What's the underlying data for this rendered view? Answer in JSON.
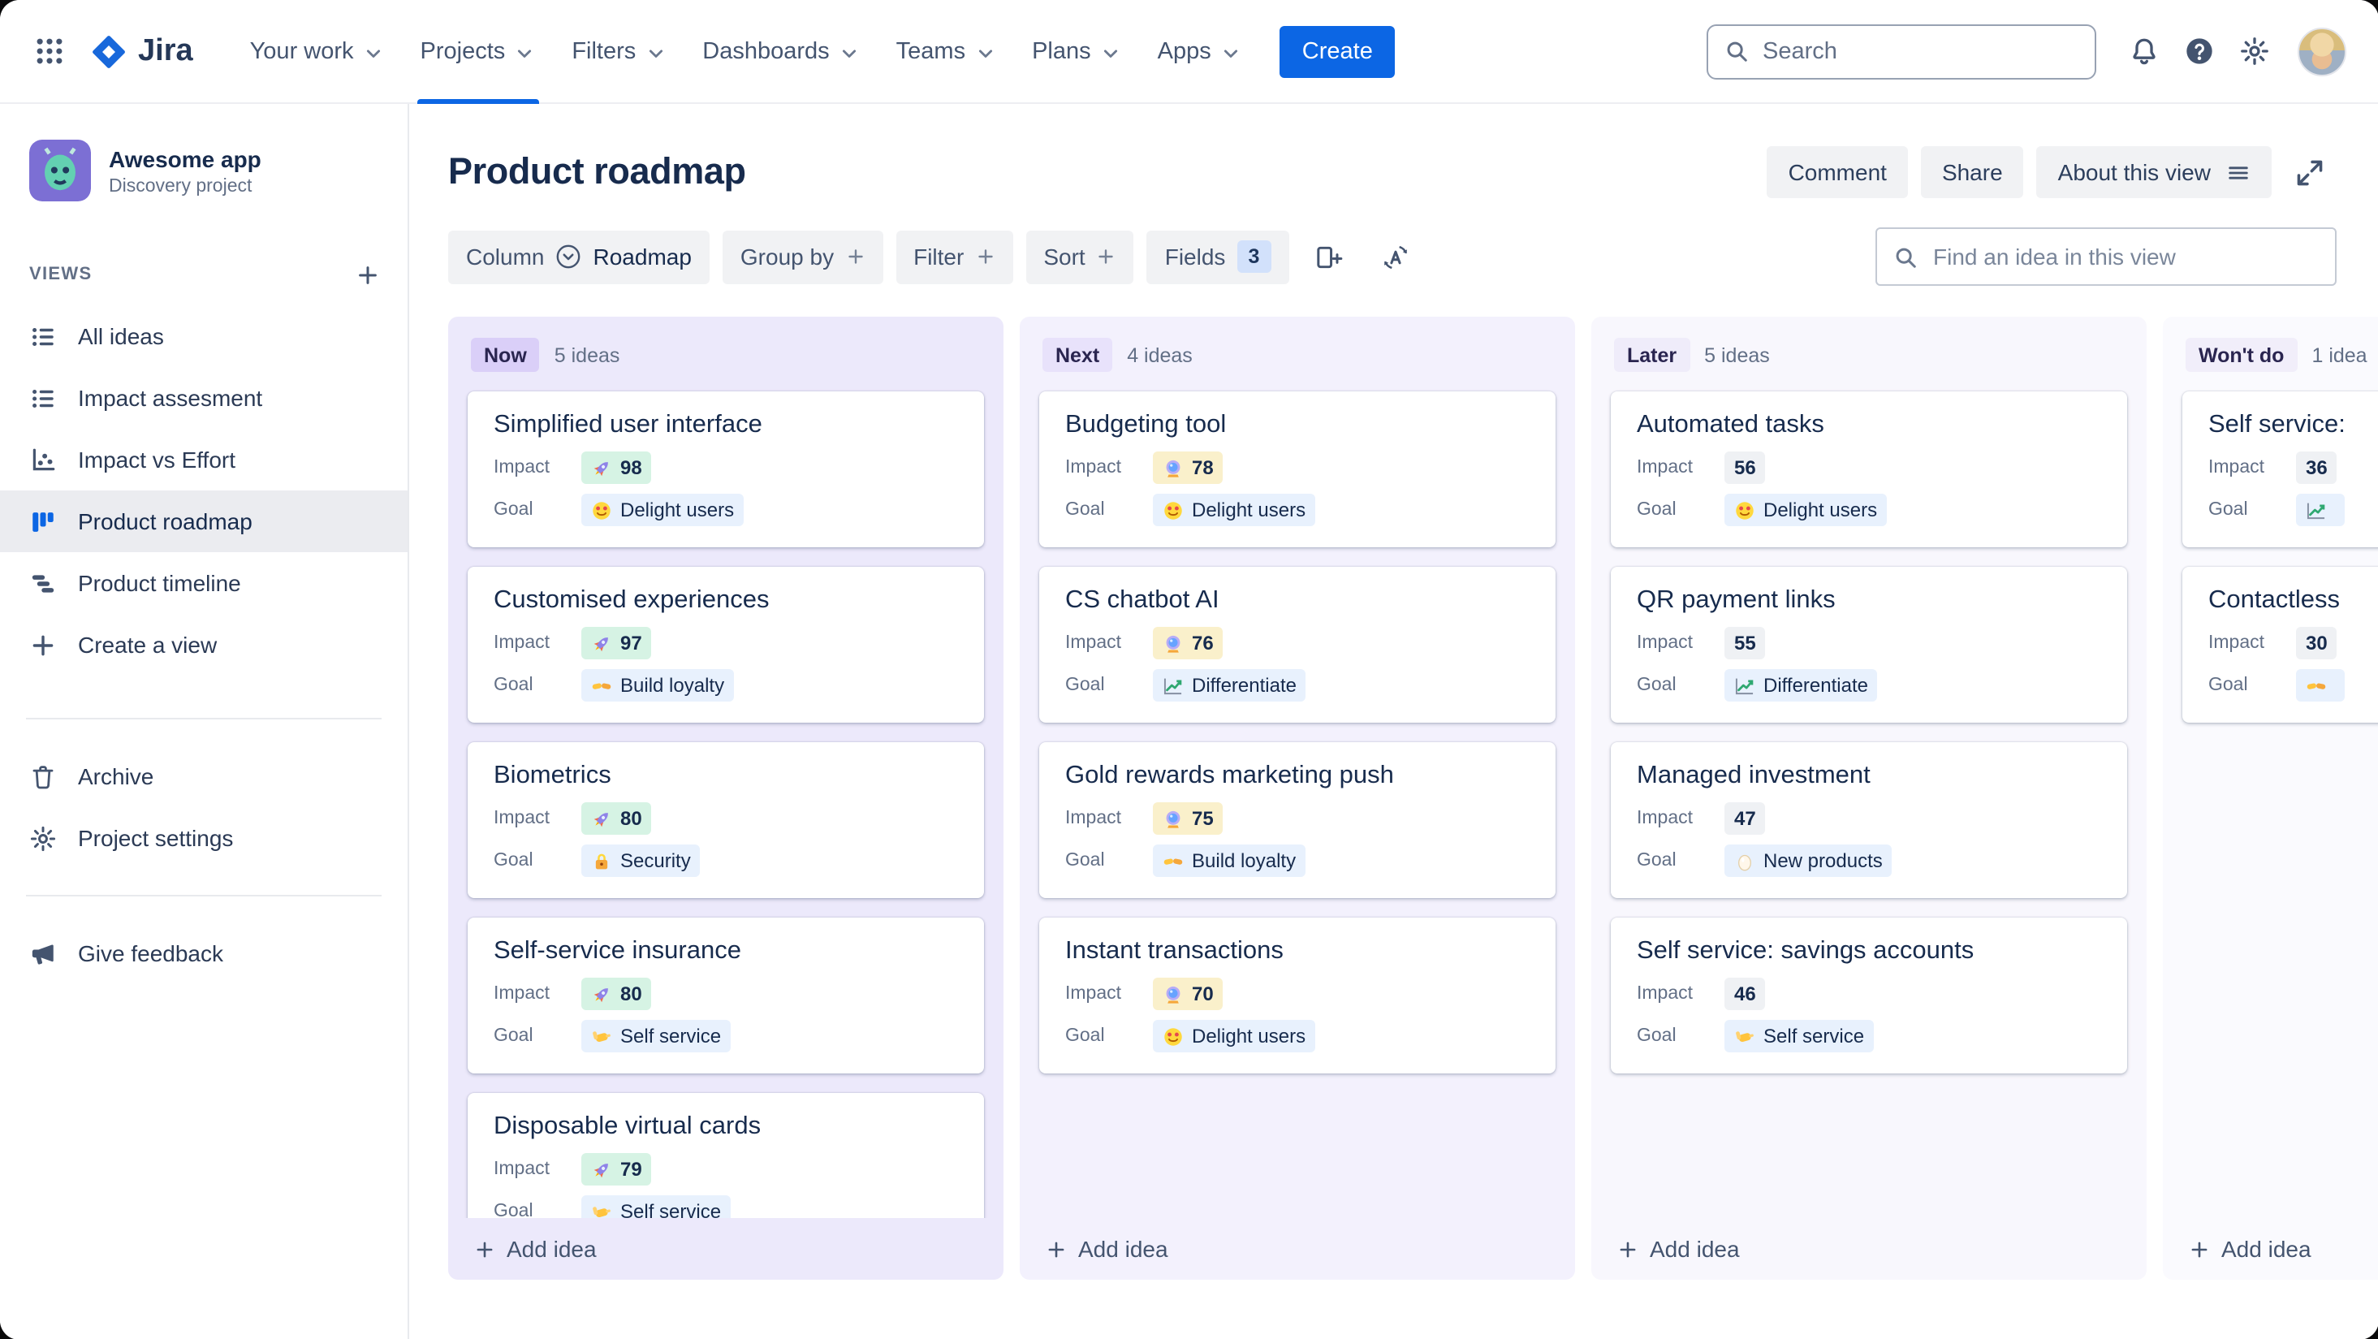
{
  "topnav": {
    "app_name": "Jira",
    "menu": [
      {
        "label": "Your work"
      },
      {
        "label": "Projects",
        "active": true
      },
      {
        "label": "Filters"
      },
      {
        "label": "Dashboards"
      },
      {
        "label": "Teams"
      },
      {
        "label": "Plans"
      },
      {
        "label": "Apps"
      }
    ],
    "create_label": "Create",
    "search_placeholder": "Search"
  },
  "sidebar": {
    "project_name": "Awesome app",
    "project_type": "Discovery project",
    "views_label": "VIEWS",
    "items": [
      {
        "label": "All ideas",
        "icon": "list"
      },
      {
        "label": "Impact assesment",
        "icon": "list"
      },
      {
        "label": "Impact vs Effort",
        "icon": "scatter"
      },
      {
        "label": "Product roadmap",
        "icon": "board",
        "active": true
      },
      {
        "label": "Product timeline",
        "icon": "timeline"
      },
      {
        "label": "Create a view",
        "icon": "plus"
      }
    ],
    "tools": [
      {
        "label": "Archive",
        "icon": "trash"
      },
      {
        "label": "Project settings",
        "icon": "gear"
      }
    ],
    "feedback_label": "Give feedback"
  },
  "header": {
    "title": "Product roadmap",
    "comment_label": "Comment",
    "share_label": "Share",
    "about_label": "About this view"
  },
  "toolbar": {
    "column_label": "Column",
    "column_value": "Roadmap",
    "group_by_label": "Group by",
    "filter_label": "Filter",
    "sort_label": "Sort",
    "fields_label": "Fields",
    "fields_count": "3",
    "find_placeholder": "Find an idea in this view"
  },
  "board": {
    "impact_label": "Impact",
    "goal_label": "Goal",
    "add_idea_label": "Add idea",
    "columns": [
      {
        "name": "Now",
        "count": "5 ideas",
        "tone": "now",
        "cards": [
          {
            "title": "Simplified user interface",
            "impact": {
              "icon": "rocket",
              "value": "98",
              "tone": "green"
            },
            "goal": {
              "icon": "heart-eyes",
              "label": "Delight users"
            }
          },
          {
            "title": "Customised experiences",
            "impact": {
              "icon": "rocket",
              "value": "97",
              "tone": "green"
            },
            "goal": {
              "icon": "handshake",
              "label": "Build loyalty"
            }
          },
          {
            "title": "Biometrics",
            "impact": {
              "icon": "rocket",
              "value": "80",
              "tone": "green"
            },
            "goal": {
              "icon": "lock",
              "label": "Security"
            }
          },
          {
            "title": "Self-service insurance",
            "impact": {
              "icon": "rocket",
              "value": "80",
              "tone": "green"
            },
            "goal": {
              "icon": "call-me",
              "label": "Self service"
            }
          },
          {
            "title": "Disposable virtual cards",
            "impact": {
              "icon": "rocket",
              "value": "79",
              "tone": "green"
            },
            "goal": {
              "icon": "call-me",
              "label": "Self service"
            }
          }
        ]
      },
      {
        "name": "Next",
        "count": "4 ideas",
        "tone": "next",
        "cards": [
          {
            "title": "Budgeting tool",
            "impact": {
              "icon": "crystal-ball",
              "value": "78",
              "tone": "yellow"
            },
            "goal": {
              "icon": "heart-eyes",
              "label": "Delight users"
            }
          },
          {
            "title": "CS chatbot AI",
            "impact": {
              "icon": "crystal-ball",
              "value": "76",
              "tone": "yellow"
            },
            "goal": {
              "icon": "chart-up",
              "label": "Differentiate"
            }
          },
          {
            "title": "Gold rewards marketing push",
            "impact": {
              "icon": "crystal-ball",
              "value": "75",
              "tone": "yellow"
            },
            "goal": {
              "icon": "handshake",
              "label": "Build loyalty"
            }
          },
          {
            "title": "Instant transactions",
            "impact": {
              "icon": "crystal-ball",
              "value": "70",
              "tone": "yellow"
            },
            "goal": {
              "icon": "heart-eyes",
              "label": "Delight users"
            }
          }
        ]
      },
      {
        "name": "Later",
        "count": "5 ideas",
        "tone": "later",
        "cards": [
          {
            "title": "Automated tasks",
            "impact": {
              "value": "56",
              "tone": "gray"
            },
            "goal": {
              "icon": "heart-eyes",
              "label": "Delight users"
            }
          },
          {
            "title": "QR payment links",
            "impact": {
              "value": "55",
              "tone": "gray"
            },
            "goal": {
              "icon": "chart-up",
              "label": "Differentiate"
            }
          },
          {
            "title": "Managed investment",
            "impact": {
              "value": "47",
              "tone": "gray"
            },
            "goal": {
              "icon": "egg",
              "label": "New products"
            }
          },
          {
            "title": "Self service: savings accounts",
            "impact": {
              "value": "46",
              "tone": "gray"
            },
            "goal": {
              "icon": "call-me",
              "label": "Self service"
            }
          }
        ]
      },
      {
        "name": "Won't do",
        "count": "1 idea",
        "tone": "wontdo",
        "cards": [
          {
            "title": "Self service:",
            "impact": {
              "value": "36",
              "tone": "gray"
            },
            "goal": {
              "icon": "chart-up",
              "label": ""
            }
          },
          {
            "title": "Contactless",
            "impact": {
              "value": "30",
              "tone": "gray"
            },
            "goal": {
              "icon": "handshake",
              "label": ""
            }
          }
        ]
      }
    ]
  },
  "palette": {
    "accent": "#0C66E4",
    "impact": {
      "green": "#D6F3E4",
      "yellow": "#FAF0CB",
      "gray": "#EFF1F4"
    },
    "goal_bg": "#E8F1FD",
    "columns": {
      "now": {
        "bg": "#ECE9FB",
        "chip": "#DACFF8"
      },
      "next": {
        "bg": "#F3F1FD",
        "chip": "#E8E2FB"
      },
      "later": {
        "bg": "#F8F7FD",
        "chip": "#EFECFA"
      },
      "wontdo": {
        "bg": "#FAFAFE",
        "chip": "#F1EEFA"
      }
    }
  }
}
